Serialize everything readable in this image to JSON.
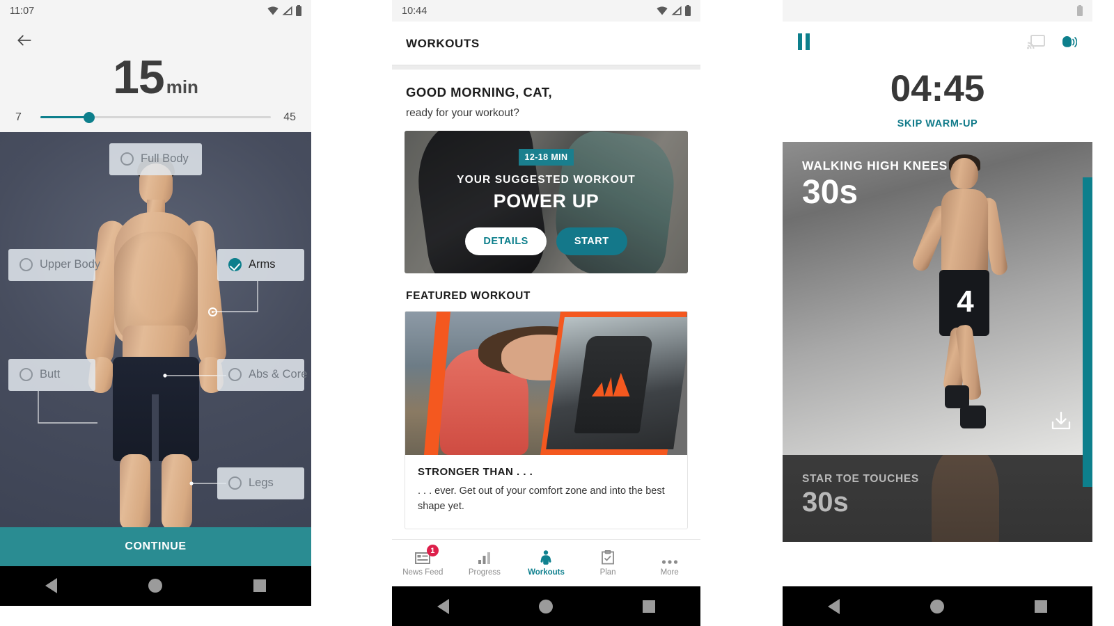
{
  "panel1": {
    "status": {
      "time": "11:07",
      "icons": [
        "wifi-icon",
        "signal-icon",
        "battery-icon"
      ]
    },
    "back_icon": "back-arrow-icon",
    "duration": {
      "value": "15",
      "unit": "min"
    },
    "slider": {
      "min": "7",
      "max": "45",
      "value": 15,
      "fill_percent": "21%",
      "accent": "#0d7f8c"
    },
    "body_parts": [
      {
        "label": "Full Body",
        "selected": false
      },
      {
        "label": "Upper Body",
        "selected": false
      },
      {
        "label": "Arms",
        "selected": true
      },
      {
        "label": "Butt",
        "selected": false
      },
      {
        "label": "Abs & Core",
        "selected": false
      },
      {
        "label": "Legs",
        "selected": false
      }
    ],
    "continue_label": "CONTINUE",
    "continue_color": "#2a8c92"
  },
  "panel2": {
    "status": {
      "time": "10:44",
      "icons": [
        "wifi-icon",
        "signal-icon",
        "battery-icon"
      ]
    },
    "app_title": "WORKOUTS",
    "greeting": {
      "title": "GOOD MORNING, CAT,",
      "subtitle": "ready for your workout?"
    },
    "suggested": {
      "badge": "12-18 MIN",
      "superlabel": "YOUR SUGGESTED WORKOUT",
      "title": "POWER UP",
      "details_label": "DETAILS",
      "start_label": "START",
      "accent": "#14788a"
    },
    "featured": {
      "section_label": "FEATURED WORKOUT",
      "title": "STRONGER THAN . . .",
      "description": ". . . ever. Get out of your comfort zone and into the best shape yet."
    },
    "tabs": [
      {
        "label": "News Feed",
        "icon": "news-feed-icon",
        "active": false,
        "badge": "1"
      },
      {
        "label": "Progress",
        "icon": "bar-chart-icon",
        "active": false,
        "badge": ""
      },
      {
        "label": "Workouts",
        "icon": "torso-icon",
        "active": true,
        "badge": ""
      },
      {
        "label": "Plan",
        "icon": "clipboard-check-icon",
        "active": false,
        "badge": ""
      },
      {
        "label": "More",
        "icon": "ellipsis-icon",
        "active": false,
        "badge": ""
      }
    ],
    "tab_active_color": "#10818f"
  },
  "panel3": {
    "status": {
      "time": "",
      "icons": [
        "battery-icon"
      ]
    },
    "toolbar": {
      "pause_icon": "pause-icon",
      "cast_icon": "cast-icon",
      "voice_icon": "voice-coach-icon"
    },
    "timer": {
      "value": "04:45",
      "skip_label": "SKIP WARM-UP",
      "accent": "#117b8a"
    },
    "exercises": [
      {
        "name": "WALKING HIGH KNEES",
        "duration": "30s",
        "rep_counter": "4",
        "current": true,
        "download_icon": "download-icon"
      },
      {
        "name": "STAR TOE TOUCHES",
        "duration": "30s",
        "rep_counter": "",
        "current": false,
        "download_icon": ""
      }
    ],
    "progress_bar_color": "#0d7f8c"
  },
  "navbar": {
    "back": "nav-back-icon",
    "home": "nav-home-icon",
    "recents": "nav-recents-icon"
  }
}
